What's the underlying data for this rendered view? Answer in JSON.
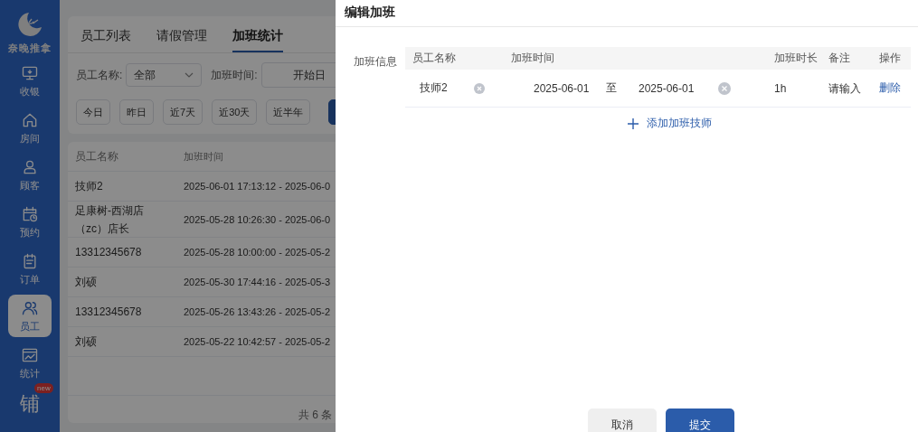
{
  "sidebar": {
    "logo_text": "奈晚推拿",
    "items": [
      {
        "label": "收银",
        "selected": false
      },
      {
        "label": "房间",
        "selected": false
      },
      {
        "label": "顾客",
        "selected": false
      },
      {
        "label": "预约",
        "selected": false
      },
      {
        "label": "订单",
        "selected": false
      },
      {
        "label": "员工",
        "selected": true
      },
      {
        "label": "统计",
        "selected": false
      }
    ],
    "extra": {
      "label": "铺",
      "badge": "new"
    }
  },
  "tabs": [
    {
      "label": "员工列表",
      "selected": false
    },
    {
      "label": "请假管理",
      "selected": false
    },
    {
      "label": "加班统计",
      "selected": true
    }
  ],
  "filters": {
    "employee": {
      "label": "员工名称:",
      "value": "全部"
    },
    "time": {
      "label": "加班时间:",
      "placeholder": "开始日"
    }
  },
  "quick_ranges": [
    "今日",
    "昨日",
    "近7天",
    "近30天",
    "近半年"
  ],
  "table": {
    "columns": [
      "员工名称",
      "加班时间"
    ],
    "rows": [
      {
        "name": "技师2",
        "time": "2025-06-01 17:13:12 - 2025-06-0"
      },
      {
        "name": "足康树-西湖店（zc）店长",
        "time": "2025-05-28 10:26:30 - 2025-06-0"
      },
      {
        "name": "13312345678",
        "time": "2025-05-28 10:00:00 - 2025-05-2"
      },
      {
        "name": "刘硕",
        "time": "2025-05-30 17:44:16 - 2025-05-3"
      },
      {
        "name": "13312345678",
        "time": "2025-05-26 13:43:26 - 2025-05-2"
      },
      {
        "name": "刘硕",
        "time": "2025-05-22 10:42:57 - 2025-05-2"
      }
    ],
    "total": "共 6 条"
  },
  "drawer": {
    "title": "编辑加班",
    "section_label": "加班信息",
    "columns": [
      "员工名称",
      "加班时间",
      "加班时长",
      "备注",
      "操作"
    ],
    "rows": [
      {
        "name": "技师2",
        "start": "2025-06-01",
        "separator": "至",
        "end": "2025-06-01",
        "duration": "1h",
        "remark": {
          "placeholder": "请输入"
        },
        "action": "删除"
      }
    ],
    "add_label": "添加加班技师",
    "buttons": [
      {
        "label": "取消",
        "kind": "secondary"
      },
      {
        "label": "提交",
        "kind": "primary"
      }
    ]
  }
}
